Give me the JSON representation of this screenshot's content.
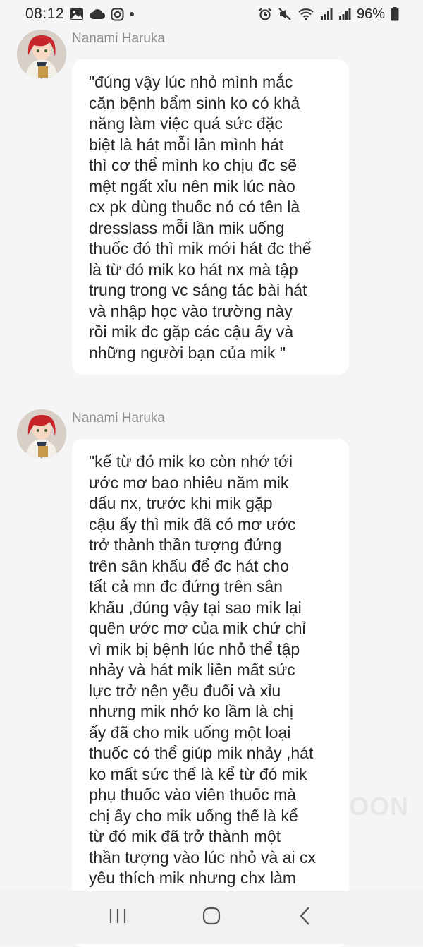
{
  "status_bar": {
    "time": "08:12",
    "battery": "96%",
    "left_icons": [
      "gallery-icon",
      "cloud-icon",
      "instagram-icon",
      "notification-dot-icon"
    ],
    "right_icons": [
      "alarm-icon",
      "mute-icon",
      "wifi-icon",
      "signal-icon",
      "signal-icon",
      "battery-icon"
    ]
  },
  "messages": [
    {
      "sender": "Nanami Haruka",
      "text": "\"đúng vậy lúc nhỏ mình mắc\ncăn bệnh bẩm sinh ko có khả\nnăng làm việc quá sức đặc\nbiệt là hát mỗi lần mình hát\nthì cơ thể mình ko chịu đc sẽ\nmệt ngất xỉu nên mik lúc nào\ncx pk dùng thuốc nó có tên là\ndresslass mỗi lần mik uống\nthuốc đó thì mik mới hát đc thế\nlà từ đó mik ko hát nx mà tập\ntrung trong vc sáng tác bài hát\nvà nhập học vào trường này\nrồi mik đc gặp các cậu ấy và\nnhững người bạn của mik \""
    },
    {
      "sender": "Nanami Haruka",
      "text": "\"kể từ đó mik ko còn nhớ tới\nước mơ bao nhiêu năm mik\ndấu nx, trước khi mik gặp\ncậu ấy thì mik đã có mơ ước\ntrở thành thần tượng đứng\ntrên sân khấu để đc hát cho\ntất cả mn đc đứng trên sân\nkhấu ,đúng vậy tại sao mik lại\nquên ước mơ của mik chứ chỉ\nvì mik bị bệnh lúc nhỏ thể tập\nnhảy và hát mik liền mất sức\nlực trở nên yếu đuối và xỉu\nnhưng mik nhớ ko lầm là chị\nấy đã cho mik uống một loại\nthuốc có thể giúp mik nhảy ,hát\nko mất sức thế là kể từ đó mik\nphụ thuốc vào viên thuốc mà\nchị ấy cho mik uống thế là kể\ntừ đó mik đã trở thành một\nthần tượng vào lúc nhỏ và ai cx\nyêu thích mik nhưng chx làm"
    }
  ],
  "watermark": "OON",
  "nav_bar": {
    "icons": [
      "recent-apps-icon",
      "home-icon",
      "back-icon"
    ]
  },
  "colors": {
    "background": "#f5f5f7",
    "bubble": "#ffffff",
    "sender": "#8c8c8c",
    "text": "#262626"
  }
}
